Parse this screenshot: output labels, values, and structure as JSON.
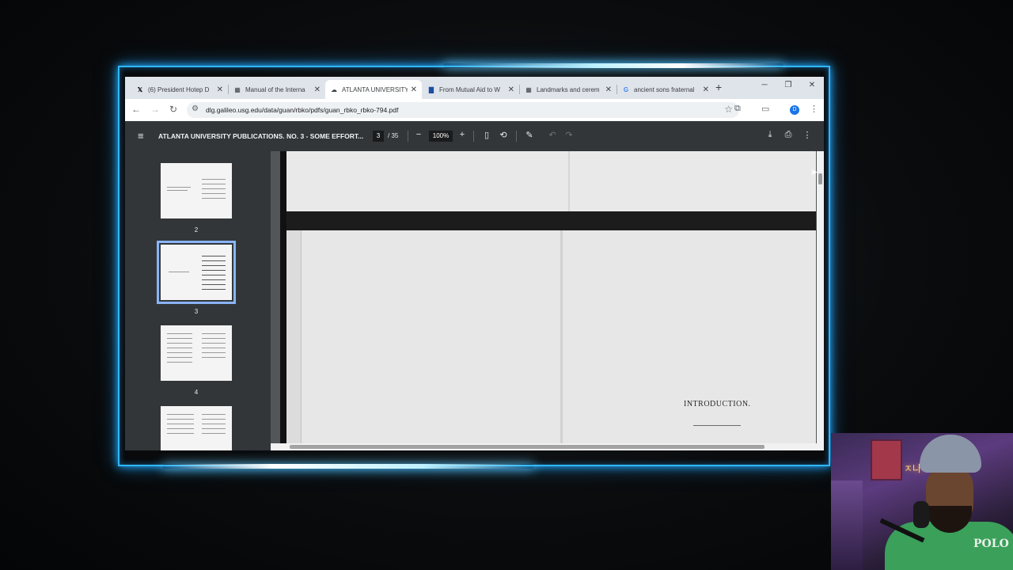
{
  "browser": {
    "tabs": [
      {
        "title": "(6) President Hotep D",
        "favicon": "x-logo-icon",
        "active": false
      },
      {
        "title": "Manual of the Interna",
        "favicon": "document-icon",
        "active": false
      },
      {
        "title": "ATLANTA UNIVERSITY",
        "favicon": "pdf-icon",
        "active": true
      },
      {
        "title": "From Mutual Aid to W",
        "favicon": "book-icon",
        "active": false
      },
      {
        "title": "Landmarks and cerem",
        "favicon": "document-icon",
        "active": false
      },
      {
        "title": "ancient sons fraternal",
        "favicon": "google-icon",
        "active": false
      }
    ],
    "new_tab_label": "+",
    "url": "dlg.galileo.usg.edu/data/guan/rbko/pdfs/guan_rbko_rbko-794.pdf",
    "profile_initial": "D"
  },
  "pdf": {
    "title": "ATLANTA UNIVERSITY PUBLICATIONS. NO. 3 - SOME EFFORT...",
    "current_page": "3",
    "total_pages": "/ 35",
    "zoom": "100%",
    "thumbnails": [
      {
        "page": "2",
        "selected": false
      },
      {
        "page": "3",
        "selected": true
      },
      {
        "page": "4",
        "selected": false
      },
      {
        "page": "",
        "selected": false
      }
    ],
    "page_heading": "INTRODUCTION."
  },
  "overlay": {
    "webcam_sign": "ㅈ나ㅇ",
    "shirt_text": "POLO"
  },
  "colors": {
    "neon": "#2fb7ff",
    "pdf_toolbar": "#323639",
    "selection": "#8ab4f8"
  }
}
